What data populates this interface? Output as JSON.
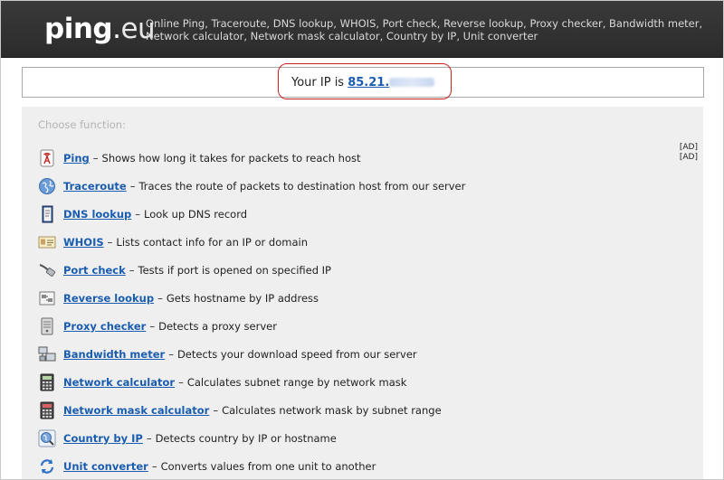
{
  "header": {
    "logo_main": "ping",
    "logo_dot": ".",
    "logo_tld": "eu",
    "links_text": "Online Ping, Traceroute, DNS lookup, WHOIS, Port check, Reverse lookup, Proxy checker, Bandwidth meter, Network calculator, Network mask calculator, Country by IP, Unit converter"
  },
  "ip": {
    "prefix": "Your IP is",
    "value": "85.21."
  },
  "panel": {
    "choose_label": "Choose function:",
    "ads": [
      "[AD]",
      "[AD]"
    ],
    "separator": "–",
    "items": [
      {
        "name": "Ping",
        "desc": "Shows how long it takes for packets to reach host",
        "icon": "ping-antenna-icon"
      },
      {
        "name": "Traceroute",
        "desc": "Traces the route of packets to destination host from our server",
        "icon": "globe-icon"
      },
      {
        "name": "DNS lookup",
        "desc": "Look up DNS record",
        "icon": "book-icon"
      },
      {
        "name": "WHOIS",
        "desc": "Lists contact info for an IP or domain",
        "icon": "id-card-icon"
      },
      {
        "name": "Port check",
        "desc": "Tests if port is opened on specified IP",
        "icon": "network-cable-icon"
      },
      {
        "name": "Reverse lookup",
        "desc": "Gets hostname by IP address",
        "icon": "reverse-lookup-icon"
      },
      {
        "name": "Proxy checker",
        "desc": "Detects a proxy server",
        "icon": "server-icon"
      },
      {
        "name": "Bandwidth meter",
        "desc": "Detects your download speed from our server",
        "icon": "computers-icon"
      },
      {
        "name": "Network calculator",
        "desc": "Calculates subnet range by network mask",
        "icon": "calculator-icon"
      },
      {
        "name": "Network mask calculator",
        "desc": "Calculates network mask by subnet range",
        "icon": "calculator-red-icon"
      },
      {
        "name": "Country by IP",
        "desc": "Detects country by IP or hostname",
        "icon": "globe-search-icon"
      },
      {
        "name": "Unit converter",
        "desc": "Converts values from one unit to another",
        "icon": "convert-arrows-icon"
      }
    ]
  }
}
